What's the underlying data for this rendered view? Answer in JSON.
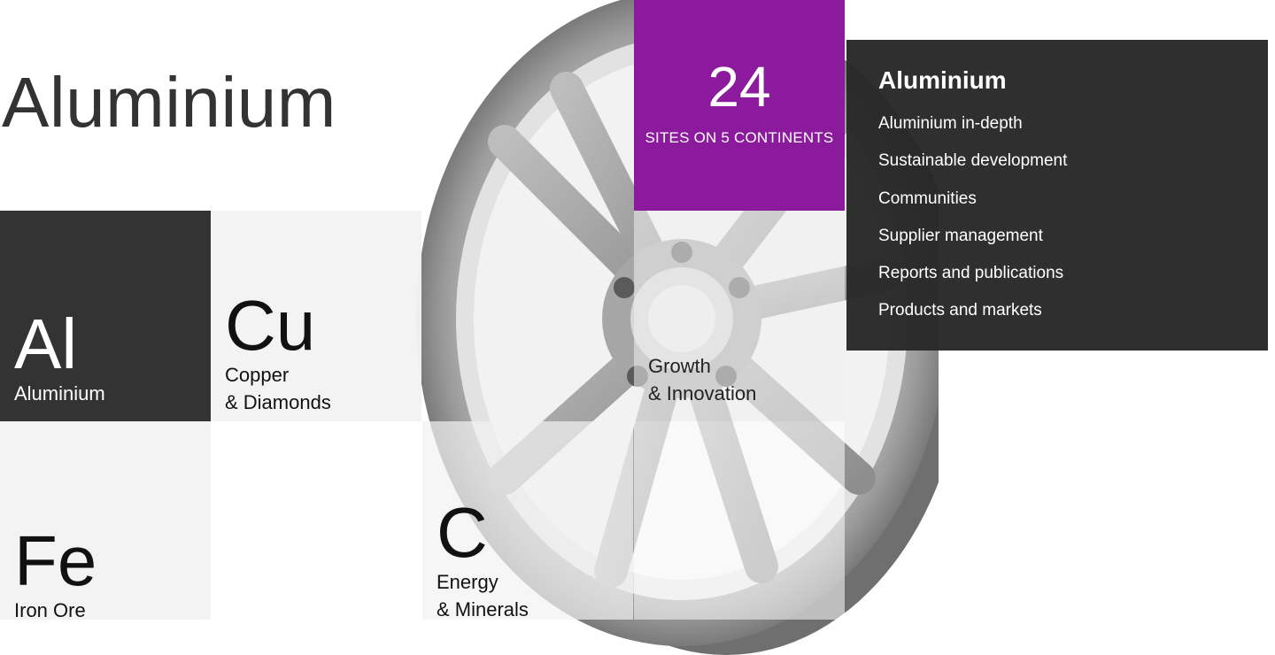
{
  "page": {
    "title": "Aluminium"
  },
  "stat": {
    "number": "24",
    "label": "SITES ON 5 CONTINENTS",
    "color": "#8b1a9c"
  },
  "menu": {
    "heading": "Aluminium",
    "items": [
      {
        "label": "Aluminium in-depth"
      },
      {
        "label": "Sustainable development"
      },
      {
        "label": "Communities"
      },
      {
        "label": "Supplier management"
      },
      {
        "label": "Reports and publications"
      },
      {
        "label": "Products and markets"
      }
    ]
  },
  "tiles": {
    "al": {
      "symbol": "Al",
      "line1": "Aluminium",
      "line2": ""
    },
    "cu": {
      "symbol": "Cu",
      "line1": "Copper",
      "line2": "& Diamonds"
    },
    "growth": {
      "symbol": "",
      "line1": "Growth",
      "line2": "& Innovation"
    },
    "fe": {
      "symbol": "Fe",
      "line1": "Iron Ore",
      "line2": ""
    },
    "c": {
      "symbol": "C",
      "line1": "Energy",
      "line2": "& Minerals"
    }
  },
  "image": {
    "icon": "alloy-wheel-image"
  }
}
